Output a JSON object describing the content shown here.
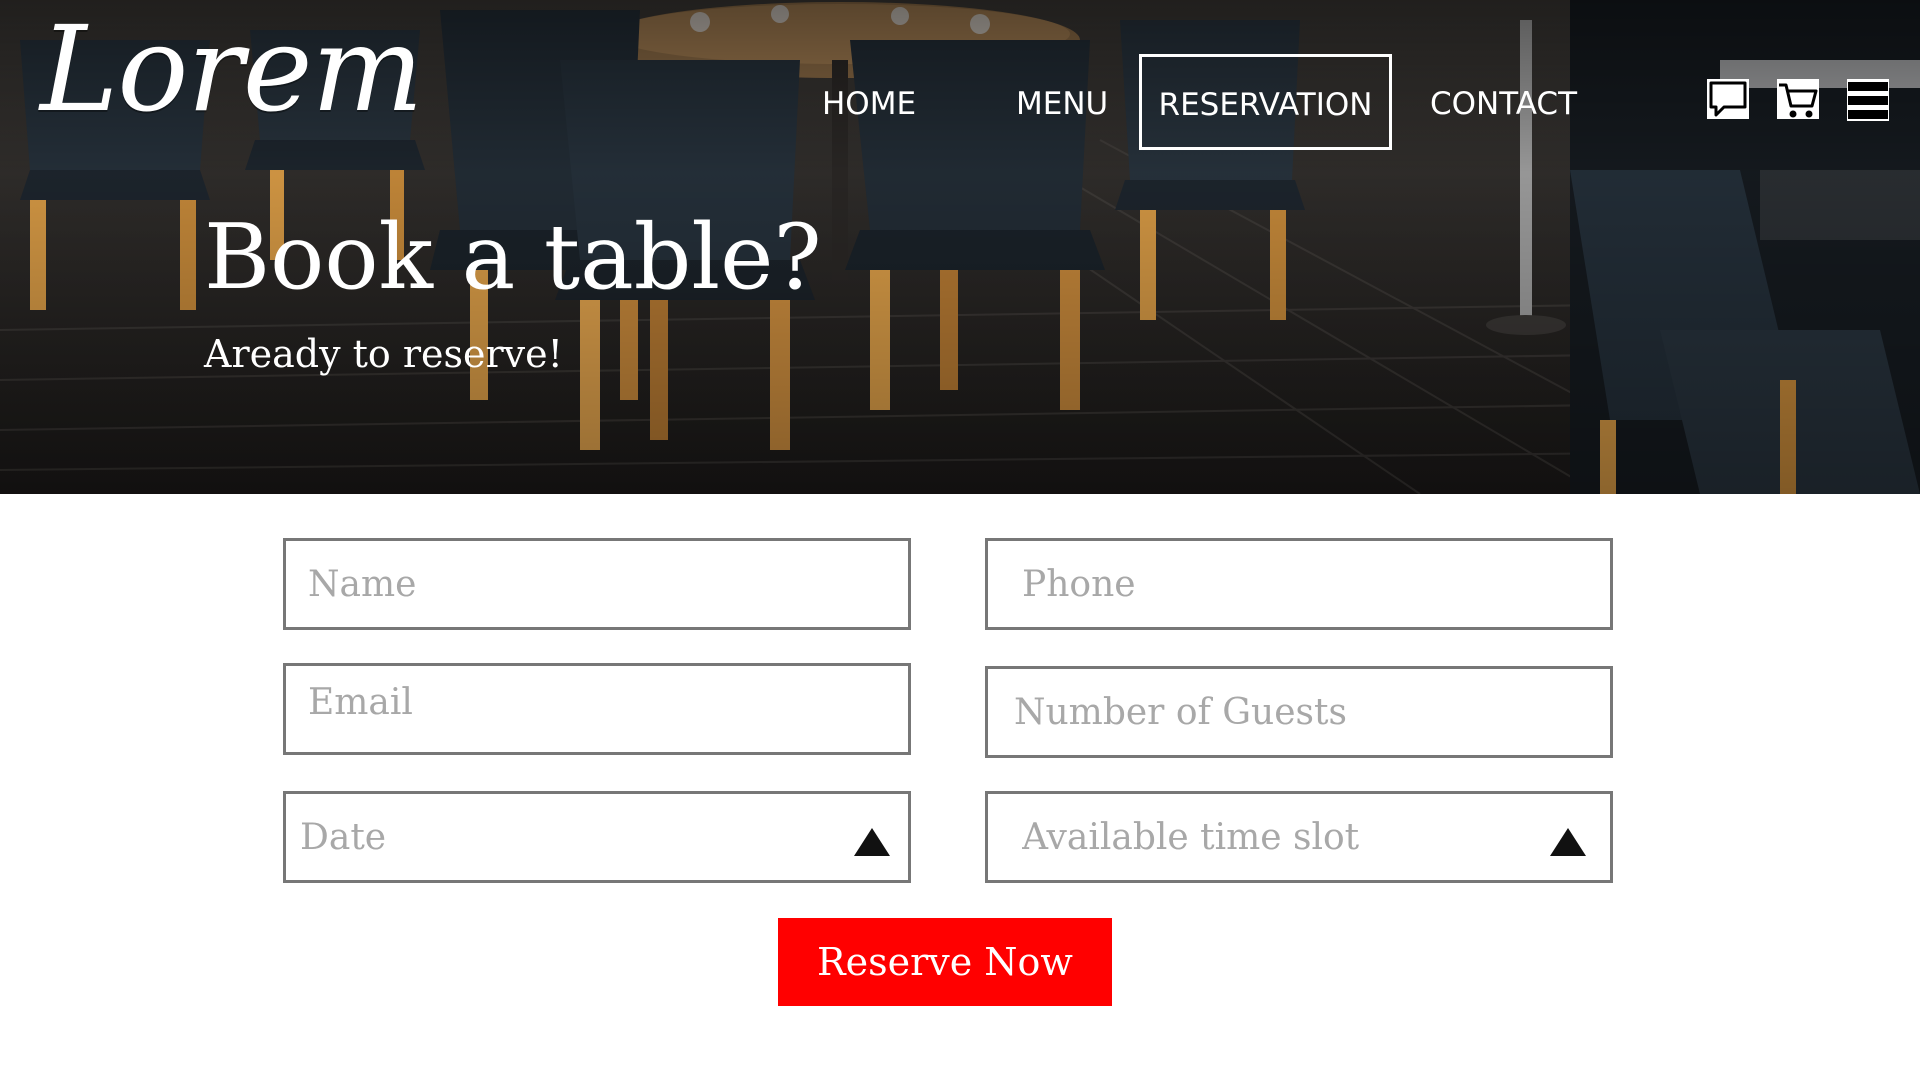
{
  "brand": {
    "logo_text": "Lorem"
  },
  "nav": {
    "items": [
      {
        "label": "HOME",
        "active": false
      },
      {
        "label": "MENU",
        "active": false
      },
      {
        "label": "RESERVATION",
        "active": true
      },
      {
        "label": "CONTACT",
        "active": false
      }
    ],
    "icons": [
      "chat-icon",
      "cart-icon",
      "menu-icon"
    ]
  },
  "hero": {
    "title": "Book a table?",
    "subtitle": "Aready to reserve!"
  },
  "form": {
    "name_placeholder": "Name",
    "phone_placeholder": "Phone",
    "email_placeholder": "Email",
    "guests_placeholder": "Number of Guests",
    "date_placeholder": "Date",
    "time_placeholder": "Available time slot",
    "submit_label": "Reserve Now"
  },
  "colors": {
    "accent": "#ff0000",
    "field_border": "#777777",
    "placeholder": "#a8a8a8"
  }
}
